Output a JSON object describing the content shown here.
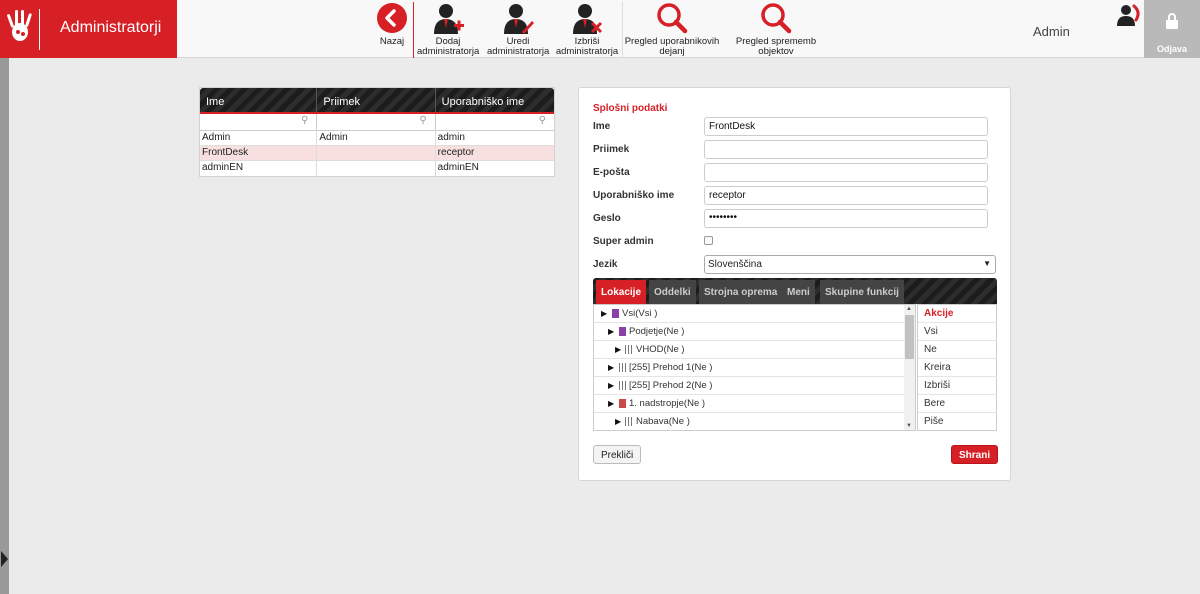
{
  "app": {
    "title": "Administratorji"
  },
  "toolbar": {
    "back": "Nazaj",
    "add": "Dodaj administratorja",
    "edit": "Uredi administratorja",
    "delete": "Izbriši administratorja",
    "user_actions": "Pregled uporabnikovih dejanj",
    "object_changes": "Pregled sprememb objektov"
  },
  "user": {
    "name": "Admin",
    "logout": "Odjava"
  },
  "table": {
    "headers": [
      "Ime",
      "Priimek",
      "Uporabniško ime"
    ],
    "rows": [
      [
        "Admin",
        "Admin",
        "admin"
      ],
      [
        "FrontDesk",
        "",
        "receptor"
      ],
      [
        "adminEN",
        "",
        "adminEN"
      ]
    ],
    "selected_row": 1
  },
  "form": {
    "section": "Splošni podatki",
    "labels": {
      "first_name": "Ime",
      "last_name": "Priimek",
      "email": "E-pošta",
      "username": "Uporabniško ime",
      "password": "Geslo",
      "super_admin": "Super admin",
      "language": "Jezik"
    },
    "values": {
      "first_name": "FrontDesk",
      "last_name": "",
      "email": "",
      "username": "receptor",
      "password": "••••••••",
      "super_admin": false,
      "language": "Slovenščina"
    },
    "tabs": [
      "Lokacije",
      "Oddelki",
      "Strojna oprema",
      "Meni",
      "Skupine funkcij"
    ],
    "active_tab": "Lokacije",
    "tree": [
      "Vsi(Vsi )",
      "Podjetje(Ne )",
      "VHOD(Ne )",
      "[255] Prehod 1(Ne )",
      "[255] Prehod 2(Ne )",
      "1. nadstropje(Ne )",
      "Nabava(Ne )"
    ],
    "actions": {
      "header": "Akcije",
      "items": [
        "Vsi",
        "Ne",
        "Kreira",
        "Izbriši",
        "Bere",
        "Piše"
      ]
    },
    "cancel": "Prekliči",
    "save": "Shrani"
  },
  "colors": {
    "accent": "#d71f26",
    "selected_row": "#f8e0e0",
    "header_dark": "#222222"
  }
}
